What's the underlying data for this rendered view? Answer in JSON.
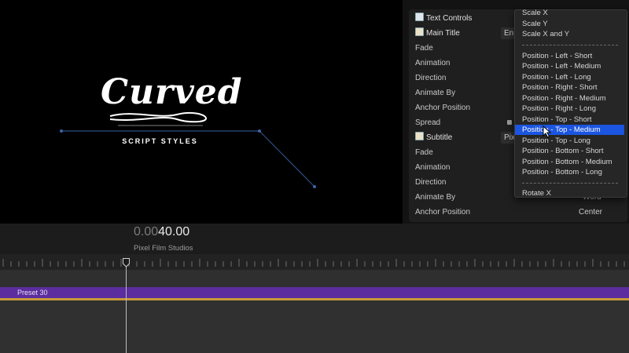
{
  "viewer": {
    "title_word": "Curved",
    "title_sub": "SCRIPT STYLES"
  },
  "inspector": {
    "rows": [
      {
        "label": "Text Controls",
        "group": true,
        "icon": "checkbox-icon"
      },
      {
        "label": "Main Title",
        "group": true,
        "icon": "edit-checkbox-icon"
      },
      {
        "label": "Fade"
      },
      {
        "label": "Animation"
      },
      {
        "label": "Direction"
      },
      {
        "label": "Animate By"
      },
      {
        "label": "Anchor Position"
      },
      {
        "label": "Spread"
      },
      {
        "label": "Subtitle",
        "group": true,
        "icon": "edit-checkbox-icon"
      },
      {
        "label": "Fade"
      },
      {
        "label": "Animation"
      },
      {
        "label": "Direction"
      },
      {
        "label": "Animate By"
      },
      {
        "label": "Anchor Position"
      }
    ],
    "main_title_field": "En",
    "subtitle_field": "Pix",
    "animate_by_value": "Word",
    "anchor_position_value": "Center"
  },
  "dropdown": {
    "items": [
      "Scale X",
      "Scale Y",
      "Scale X and Y",
      "Position - Left - Short",
      "Position - Left - Medium",
      "Position - Left - Long",
      "Position - Right - Short",
      "Position - Right - Medium",
      "Position - Right - Long",
      "Position - Top - Short",
      "Position - Top - Medium",
      "Position - Top - Long",
      "Position - Bottom - Short",
      "Position - Bottom - Medium",
      "Position - Bottom - Long",
      "Rotate X"
    ],
    "selected": "Position - Top - Medium"
  },
  "timeline": {
    "timecode_dim": "0.00",
    "timecode_bright": "40.00",
    "project_name": "Pixel Film Studios",
    "clip_label": "Preset 30"
  },
  "colors": {
    "selection": "#1b55e0",
    "clip": "#5b2d9e",
    "clip_border": "#c89a3a",
    "guide_line": "#2f4f86"
  }
}
